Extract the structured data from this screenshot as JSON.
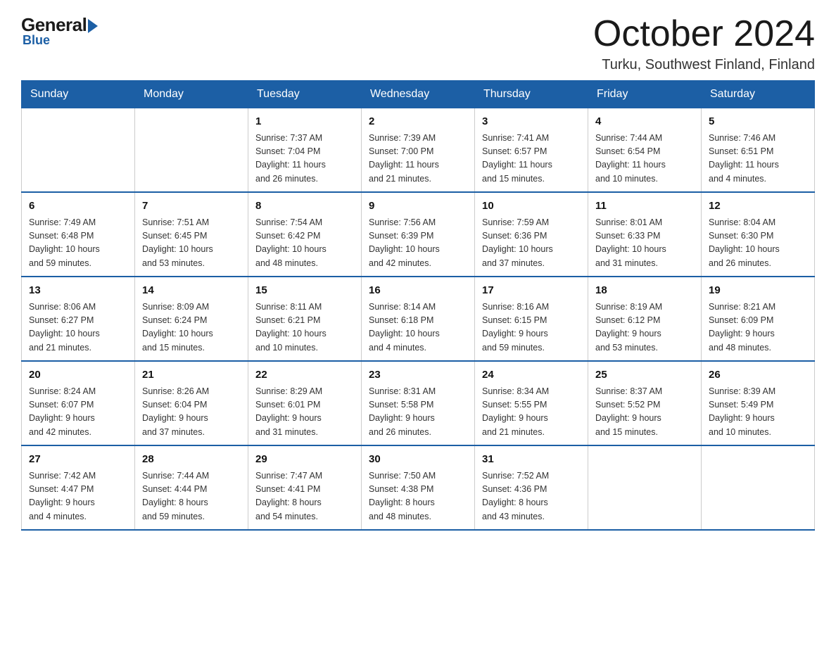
{
  "logo": {
    "general": "General",
    "blue": "Blue"
  },
  "header": {
    "month": "October 2024",
    "location": "Turku, Southwest Finland, Finland"
  },
  "weekdays": [
    "Sunday",
    "Monday",
    "Tuesday",
    "Wednesday",
    "Thursday",
    "Friday",
    "Saturday"
  ],
  "weeks": [
    [
      {
        "day": "",
        "info": ""
      },
      {
        "day": "",
        "info": ""
      },
      {
        "day": "1",
        "info": "Sunrise: 7:37 AM\nSunset: 7:04 PM\nDaylight: 11 hours\nand 26 minutes."
      },
      {
        "day": "2",
        "info": "Sunrise: 7:39 AM\nSunset: 7:00 PM\nDaylight: 11 hours\nand 21 minutes."
      },
      {
        "day": "3",
        "info": "Sunrise: 7:41 AM\nSunset: 6:57 PM\nDaylight: 11 hours\nand 15 minutes."
      },
      {
        "day": "4",
        "info": "Sunrise: 7:44 AM\nSunset: 6:54 PM\nDaylight: 11 hours\nand 10 minutes."
      },
      {
        "day": "5",
        "info": "Sunrise: 7:46 AM\nSunset: 6:51 PM\nDaylight: 11 hours\nand 4 minutes."
      }
    ],
    [
      {
        "day": "6",
        "info": "Sunrise: 7:49 AM\nSunset: 6:48 PM\nDaylight: 10 hours\nand 59 minutes."
      },
      {
        "day": "7",
        "info": "Sunrise: 7:51 AM\nSunset: 6:45 PM\nDaylight: 10 hours\nand 53 minutes."
      },
      {
        "day": "8",
        "info": "Sunrise: 7:54 AM\nSunset: 6:42 PM\nDaylight: 10 hours\nand 48 minutes."
      },
      {
        "day": "9",
        "info": "Sunrise: 7:56 AM\nSunset: 6:39 PM\nDaylight: 10 hours\nand 42 minutes."
      },
      {
        "day": "10",
        "info": "Sunrise: 7:59 AM\nSunset: 6:36 PM\nDaylight: 10 hours\nand 37 minutes."
      },
      {
        "day": "11",
        "info": "Sunrise: 8:01 AM\nSunset: 6:33 PM\nDaylight: 10 hours\nand 31 minutes."
      },
      {
        "day": "12",
        "info": "Sunrise: 8:04 AM\nSunset: 6:30 PM\nDaylight: 10 hours\nand 26 minutes."
      }
    ],
    [
      {
        "day": "13",
        "info": "Sunrise: 8:06 AM\nSunset: 6:27 PM\nDaylight: 10 hours\nand 21 minutes."
      },
      {
        "day": "14",
        "info": "Sunrise: 8:09 AM\nSunset: 6:24 PM\nDaylight: 10 hours\nand 15 minutes."
      },
      {
        "day": "15",
        "info": "Sunrise: 8:11 AM\nSunset: 6:21 PM\nDaylight: 10 hours\nand 10 minutes."
      },
      {
        "day": "16",
        "info": "Sunrise: 8:14 AM\nSunset: 6:18 PM\nDaylight: 10 hours\nand 4 minutes."
      },
      {
        "day": "17",
        "info": "Sunrise: 8:16 AM\nSunset: 6:15 PM\nDaylight: 9 hours\nand 59 minutes."
      },
      {
        "day": "18",
        "info": "Sunrise: 8:19 AM\nSunset: 6:12 PM\nDaylight: 9 hours\nand 53 minutes."
      },
      {
        "day": "19",
        "info": "Sunrise: 8:21 AM\nSunset: 6:09 PM\nDaylight: 9 hours\nand 48 minutes."
      }
    ],
    [
      {
        "day": "20",
        "info": "Sunrise: 8:24 AM\nSunset: 6:07 PM\nDaylight: 9 hours\nand 42 minutes."
      },
      {
        "day": "21",
        "info": "Sunrise: 8:26 AM\nSunset: 6:04 PM\nDaylight: 9 hours\nand 37 minutes."
      },
      {
        "day": "22",
        "info": "Sunrise: 8:29 AM\nSunset: 6:01 PM\nDaylight: 9 hours\nand 31 minutes."
      },
      {
        "day": "23",
        "info": "Sunrise: 8:31 AM\nSunset: 5:58 PM\nDaylight: 9 hours\nand 26 minutes."
      },
      {
        "day": "24",
        "info": "Sunrise: 8:34 AM\nSunset: 5:55 PM\nDaylight: 9 hours\nand 21 minutes."
      },
      {
        "day": "25",
        "info": "Sunrise: 8:37 AM\nSunset: 5:52 PM\nDaylight: 9 hours\nand 15 minutes."
      },
      {
        "day": "26",
        "info": "Sunrise: 8:39 AM\nSunset: 5:49 PM\nDaylight: 9 hours\nand 10 minutes."
      }
    ],
    [
      {
        "day": "27",
        "info": "Sunrise: 7:42 AM\nSunset: 4:47 PM\nDaylight: 9 hours\nand 4 minutes."
      },
      {
        "day": "28",
        "info": "Sunrise: 7:44 AM\nSunset: 4:44 PM\nDaylight: 8 hours\nand 59 minutes."
      },
      {
        "day": "29",
        "info": "Sunrise: 7:47 AM\nSunset: 4:41 PM\nDaylight: 8 hours\nand 54 minutes."
      },
      {
        "day": "30",
        "info": "Sunrise: 7:50 AM\nSunset: 4:38 PM\nDaylight: 8 hours\nand 48 minutes."
      },
      {
        "day": "31",
        "info": "Sunrise: 7:52 AM\nSunset: 4:36 PM\nDaylight: 8 hours\nand 43 minutes."
      },
      {
        "day": "",
        "info": ""
      },
      {
        "day": "",
        "info": ""
      }
    ]
  ]
}
